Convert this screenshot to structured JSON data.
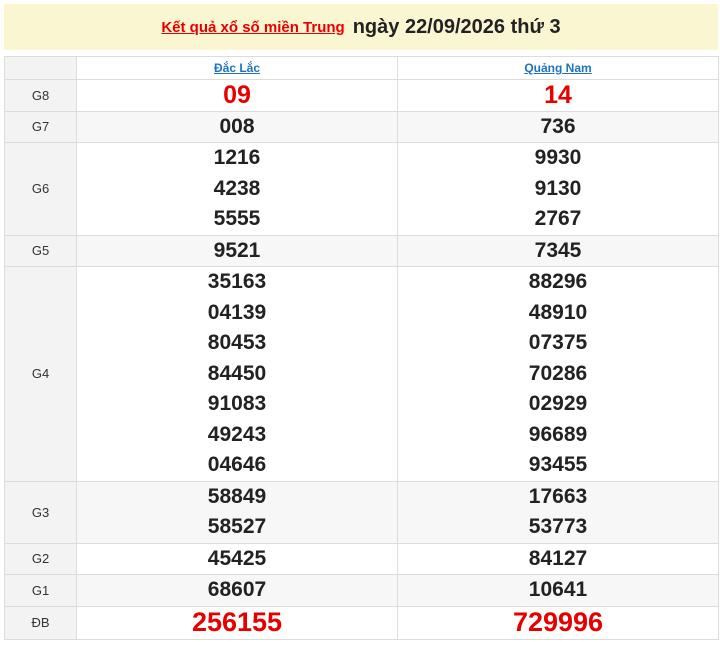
{
  "header": {
    "link_text": "Kết quả xổ số miền Trung",
    "date_text": "ngày 22/09/2026 thứ 3"
  },
  "columns": [
    "Đắc Lắc",
    "Quảng Nam"
  ],
  "prizes": [
    {
      "label": "G8",
      "values": [
        [
          "09"
        ],
        [
          "14"
        ]
      ]
    },
    {
      "label": "G7",
      "values": [
        [
          "008"
        ],
        [
          "736"
        ]
      ]
    },
    {
      "label": "G6",
      "values": [
        [
          "1216",
          "4238",
          "5555"
        ],
        [
          "9930",
          "9130",
          "2767"
        ]
      ]
    },
    {
      "label": "G5",
      "values": [
        [
          "9521"
        ],
        [
          "7345"
        ]
      ]
    },
    {
      "label": "G4",
      "values": [
        [
          "35163",
          "04139",
          "80453",
          "84450",
          "91083",
          "49243",
          "04646"
        ],
        [
          "88296",
          "48910",
          "07375",
          "70286",
          "02929",
          "96689",
          "93455"
        ]
      ]
    },
    {
      "label": "G3",
      "values": [
        [
          "58849",
          "58527"
        ],
        [
          "17663",
          "53773"
        ]
      ]
    },
    {
      "label": "G2",
      "values": [
        [
          "45425"
        ],
        [
          "84127"
        ]
      ]
    },
    {
      "label": "G1",
      "values": [
        [
          "68607"
        ],
        [
          "10641"
        ]
      ]
    },
    {
      "label": "ĐB",
      "values": [
        [
          "256155"
        ],
        [
          "729996"
        ]
      ]
    }
  ],
  "colors": {
    "accent_red": "#e60000",
    "link_blue": "#1e73be",
    "header_bg": "#fbf6d2"
  }
}
